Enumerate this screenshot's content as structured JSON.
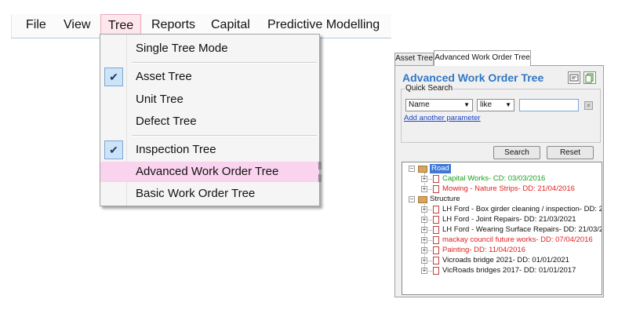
{
  "menubar": {
    "items": [
      {
        "label": "File"
      },
      {
        "label": "View"
      },
      {
        "label": "Tree"
      },
      {
        "label": "Reports"
      },
      {
        "label": "Capital"
      },
      {
        "label": "Predictive Modelling"
      }
    ]
  },
  "tree_menu": {
    "items": [
      {
        "label": "Single Tree Mode",
        "checked": false
      },
      {
        "label": "Asset Tree",
        "checked": true
      },
      {
        "label": "Unit Tree",
        "checked": false
      },
      {
        "label": "Defect Tree",
        "checked": false
      },
      {
        "label": "Inspection Tree",
        "checked": true
      },
      {
        "label": "Advanced Work Order Tree",
        "checked": false,
        "highlighted": true
      },
      {
        "label": "Basic Work Order Tree",
        "checked": false
      }
    ],
    "check_glyph": "✔"
  },
  "panel": {
    "tabs": [
      {
        "label": "Asset Tree",
        "active": false
      },
      {
        "label": "Advanced Work Order Tree",
        "active": true
      }
    ],
    "title": "Advanced Work Order Tree",
    "quick_search": {
      "title": "Quick Search",
      "field_value": "Name",
      "operator_value": "like",
      "search_value": "",
      "add_link": "Add another parameter",
      "search_label": "Search",
      "reset_label": "Reset"
    },
    "tree": {
      "nodes": [
        {
          "label": "Road",
          "level": 0,
          "kind": "folder",
          "selected": true,
          "color": "#0000ff"
        },
        {
          "label": "Capital Works- CD: 03/03/2016",
          "level": 1,
          "kind": "doc",
          "color": "#1e9e1e"
        },
        {
          "label": "Mowing - Nature Strips- DD: 21/04/2016",
          "level": 1,
          "kind": "doc",
          "color": "#e02020"
        },
        {
          "label": "Structure",
          "level": 0,
          "kind": "folder",
          "color": "#111111"
        },
        {
          "label": "LH Ford - Box girder cleaning / inspection- DD: 21/",
          "level": 1,
          "kind": "doc",
          "color": "#111111"
        },
        {
          "label": "LH Ford - Joint Repairs- DD: 21/03/2021",
          "level": 1,
          "kind": "doc",
          "color": "#111111"
        },
        {
          "label": "LH Ford - Wearing Surface Repairs- DD: 21/03/20",
          "level": 1,
          "kind": "doc",
          "color": "#111111"
        },
        {
          "label": "mackay council future works- DD: 07/04/2016",
          "level": 1,
          "kind": "doc",
          "color": "#e02020"
        },
        {
          "label": "Painting- DD: 11/04/2016",
          "level": 1,
          "kind": "doc",
          "color": "#e02020"
        },
        {
          "label": "Vicroads bridge 2021- DD: 01/01/2021",
          "level": 1,
          "kind": "doc",
          "color": "#111111"
        },
        {
          "label": "VicRoads bridges 2017- DD: 01/01/2017",
          "level": 1,
          "kind": "doc",
          "color": "#111111"
        }
      ]
    }
  }
}
